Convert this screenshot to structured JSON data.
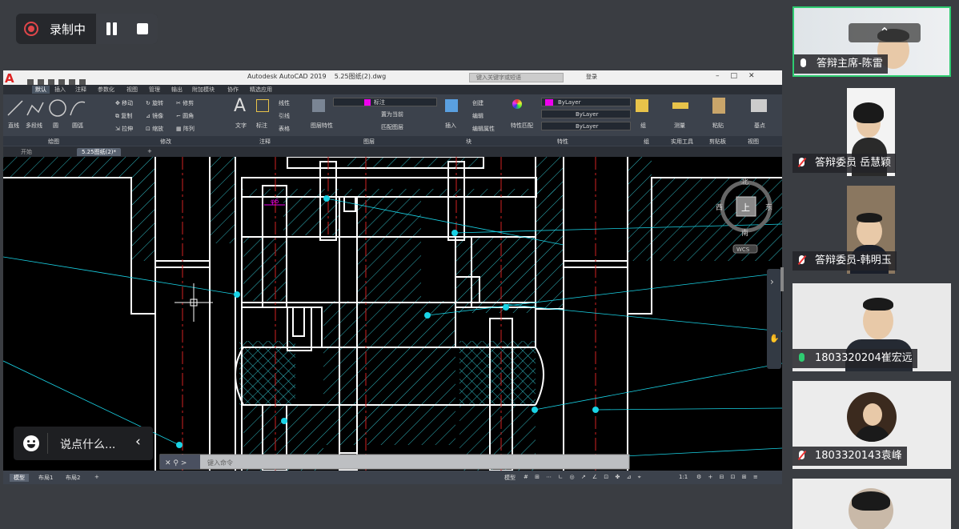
{
  "recording": {
    "label": "录制中"
  },
  "autocad": {
    "app_title": "Autodesk AutoCAD 2019",
    "file_name": "5.25图纸(2).dwg",
    "search_placeholder": "键入关键字或短语",
    "user_label": "登录",
    "ribbon_tabs": [
      "默认",
      "插入",
      "注释",
      "参数化",
      "视图",
      "管理",
      "输出",
      "附加模块",
      "协作",
      "精选应用"
    ],
    "tools": {
      "line": "直线",
      "polyline": "多段线",
      "circle": "圆",
      "arc": "圆弧",
      "move": "移动",
      "rotate": "旋转",
      "trim": "修剪",
      "copy": "复制",
      "mirror": "镜像",
      "fillet": "圆角",
      "stretch": "拉伸",
      "scale": "缩放",
      "array": "阵列",
      "text": "文字",
      "dimension": "标注",
      "leader": "引线",
      "table": "表格",
      "linear": "线性",
      "layer_props": "图层特性",
      "layer_name": "标注",
      "make_current": "置为当前",
      "match_layer": "匹配图层",
      "insert": "插入",
      "create": "创建",
      "edit": "编辑",
      "edit_attr": "编辑属性",
      "match_props": "特性匹配",
      "group": "组",
      "measure": "测量",
      "paste": "粘贴",
      "base": "基点"
    },
    "bylayer": [
      "ByLayer",
      "ByLayer",
      "ByLayer"
    ],
    "panels": [
      "绘图",
      "修改",
      "注释",
      "图层",
      "块",
      "特性",
      "组",
      "实用工具",
      "剪贴板",
      "视图"
    ],
    "doc_tabs": [
      "开始",
      "5.25图纸(2)*"
    ],
    "viewcube": {
      "top": "上",
      "north": "北",
      "south": "南",
      "east": "东",
      "west": "西",
      "wcs": "WCS"
    },
    "command_placeholder": "键入命令",
    "layout_tabs": [
      "模型",
      "布局1",
      "布局2"
    ],
    "status_model": "模型",
    "status_scale": "1:1",
    "dim_text": "φ6"
  },
  "chat": {
    "placeholder": "说点什么..."
  },
  "participants": [
    {
      "name": "答辩主席-陈雷",
      "mic": "on"
    },
    {
      "name": "答辩委员 岳慧颖",
      "mic": "off"
    },
    {
      "name": "答辩委员-韩明玉",
      "mic": "off"
    },
    {
      "name": "1803320204崔宏远",
      "mic": "on"
    },
    {
      "name": "1803320143袁峰",
      "mic": "off"
    }
  ],
  "colors": {
    "hatch": "#33c6cc",
    "line": "#ffffff",
    "center": "#d22222",
    "node": "#19d3e6",
    "active_green": "#2ecc71"
  }
}
